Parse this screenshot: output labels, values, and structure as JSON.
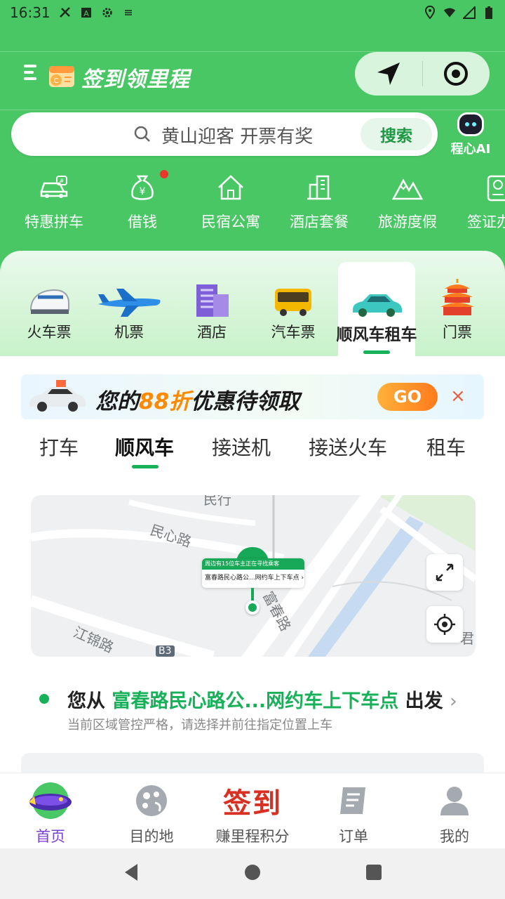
{
  "status_bar": {
    "time": "16:31"
  },
  "header": {
    "brand_title": "签到领里程",
    "search": {
      "placeholder_text": "黄山迎客 开票有奖",
      "button_label": "搜索"
    },
    "ai_label": "程心AI"
  },
  "quick_entries": [
    {
      "label": "特惠拼车",
      "icon": "car-pool-icon"
    },
    {
      "label": "借钱",
      "icon": "money-bag-icon"
    },
    {
      "label": "民宿公寓",
      "icon": "house-icon"
    },
    {
      "label": "酒店套餐",
      "icon": "hotel-building-icon"
    },
    {
      "label": "旅游度假",
      "icon": "mountain-icon"
    },
    {
      "label": "签证办",
      "icon": "passport-icon"
    }
  ],
  "categories": [
    {
      "label": "火车票"
    },
    {
      "label": "机票"
    },
    {
      "label": "酒店"
    },
    {
      "label": "汽车票"
    },
    {
      "label": "顺风车租车",
      "active": true
    },
    {
      "label": "门票"
    }
  ],
  "promo": {
    "text_prefix": "您的",
    "text_highlight": "88折",
    "text_suffix": "优惠待领取",
    "go_label": "GO",
    "close_symbol": "×"
  },
  "ride_tabs": [
    {
      "label": "打车"
    },
    {
      "label": "顺风车",
      "active": true
    },
    {
      "label": "接送机"
    },
    {
      "label": "接送火车"
    },
    {
      "label": "租车"
    }
  ],
  "map": {
    "road_labels": [
      "民心路",
      "江锦路",
      "富春路",
      "B3",
      "君",
      "民行"
    ],
    "pin_top": "周边有15位车主正在寻找乘客",
    "pin_bottom": "富春路民心路公...网约车上下车点 ›"
  },
  "departure": {
    "prefix": "您从",
    "location": "富春路民心路公...网约车上下车点",
    "suffix": "出发",
    "arrow": "›",
    "note": "当前区域管控严格，请选择并前往指定位置上车"
  },
  "bottom_nav": [
    {
      "label": "首页",
      "active": true
    },
    {
      "label": "目的地"
    },
    {
      "label": "赚里程积分",
      "badge_text": "签到"
    },
    {
      "label": "订单"
    },
    {
      "label": "我的"
    }
  ],
  "colors": {
    "brand_green": "#4ac765",
    "accent_green": "#17b15a",
    "active_purple": "#7c3fd6",
    "promo_orange": "#ff8a00"
  }
}
